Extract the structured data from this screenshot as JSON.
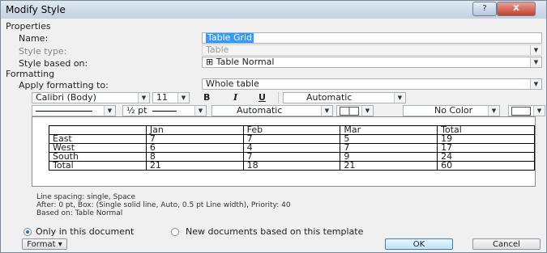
{
  "window": {
    "title": "Modify Style",
    "help_label": "?",
    "close_label": "X"
  },
  "properties": {
    "heading": "Properties",
    "name_label": "Name:",
    "name_value": "Table Grid",
    "type_label": "Style type:",
    "type_value": "Table",
    "based_label": "Style based on:",
    "based_value": "Table Normal"
  },
  "formatting": {
    "heading": "Formatting",
    "apply_label": "Apply formatting to:",
    "apply_value": "Whole table",
    "font": "Calibri (Body)",
    "size": "11",
    "bold": "B",
    "italic": "I",
    "underline": "U",
    "font_color": "Automatic",
    "border_width": "½ pt",
    "border_color": "Automatic",
    "shading": "No Color"
  },
  "preview": {
    "headers": [
      "",
      "Jan",
      "Feb",
      "Mar",
      "Total"
    ],
    "rows": [
      [
        "East",
        "7",
        "7",
        "5",
        "19"
      ],
      [
        "West",
        "6",
        "4",
        "7",
        "17"
      ],
      [
        "South",
        "8",
        "7",
        "9",
        "24"
      ],
      [
        "Total",
        "21",
        "18",
        "21",
        "60"
      ]
    ]
  },
  "description": {
    "line1": "Line spacing:  single, Space",
    "line2": "After:  0 pt, Box: (Single solid line, Auto,  0.5 pt Line width), Priority: 40",
    "line3": "Based on: Table Normal"
  },
  "options": {
    "only_doc": "Only in this document",
    "new_docs": "New documents based on this template",
    "only_doc_selected": true
  },
  "buttons": {
    "format": "Format ▾",
    "ok": "OK",
    "cancel": "Cancel"
  },
  "colors": {
    "titlebar": "#c2d0e0",
    "highlight": "#3399ff",
    "close": "#c4402d"
  }
}
